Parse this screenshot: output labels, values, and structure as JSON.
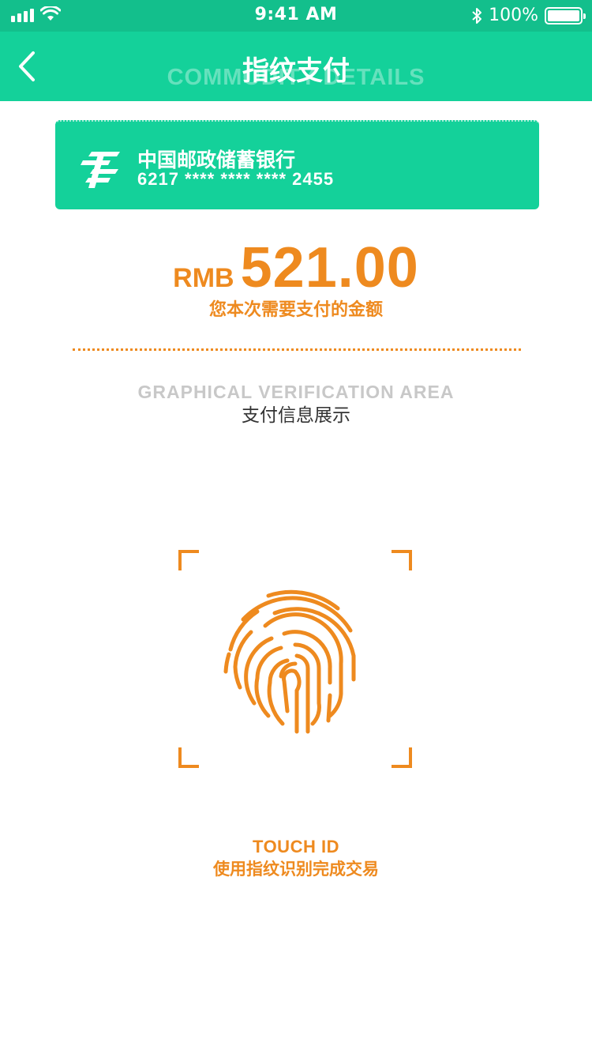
{
  "status_bar": {
    "time": "9:41 AM",
    "battery": "100%",
    "signal_icon": "signal-bars-icon",
    "wifi_icon": "wifi-icon",
    "bluetooth_icon": "bluetooth-icon"
  },
  "nav": {
    "title": "指纹支付",
    "subtitle": "COMMODITY DETAILS",
    "back_icon": "chevron-left-icon"
  },
  "card": {
    "bank_name": "中国邮政储蓄银行",
    "card_number": "6217 **** **** **** 2455",
    "logo_icon": "postal-bank-logo"
  },
  "payment": {
    "currency": "RMB",
    "amount": "521.00",
    "caption": "您本次需要支付的金额"
  },
  "info_area": {
    "watermark": "GRAPHICAL VERIFICATION AREA",
    "title": "支付信息展示"
  },
  "touch": {
    "label": "TOUCH ID",
    "caption": "使用指纹识别完成交易",
    "icon": "fingerprint-icon"
  },
  "colors": {
    "status_bar": "#13bf8c",
    "nav_bar": "#14d19a",
    "accent": "#ee8a1f",
    "text": "#333333"
  }
}
